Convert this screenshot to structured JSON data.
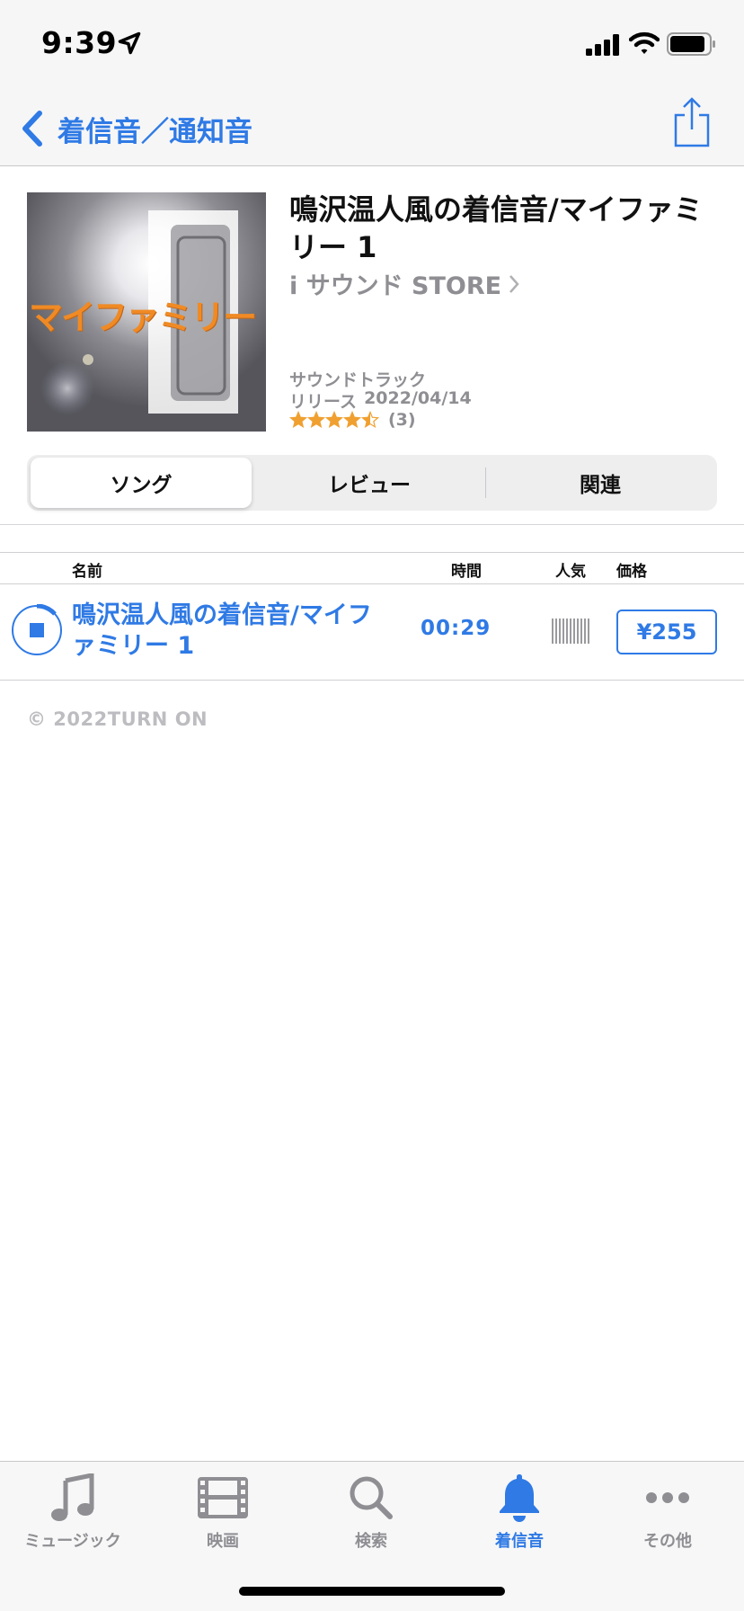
{
  "status_bar": {
    "time": "9:39",
    "icons": [
      "location-arrow-icon",
      "signal-icon",
      "wifi-icon",
      "battery-icon"
    ]
  },
  "nav": {
    "back_label": "着信音／通知音",
    "share_icon": "share-icon"
  },
  "album": {
    "artwork_text": "マイファミリー",
    "title": "鳴沢温人風の着信音/マイファミリー 1",
    "artist": "i サウンド STORE",
    "genre": "サウンドトラック",
    "release_label": "リリース",
    "release_date": "2022/04/14",
    "rating_stars": 4.5,
    "rating_count": "(3)"
  },
  "segments": [
    {
      "label": "ソング",
      "selected": true
    },
    {
      "label": "レビュー",
      "selected": false
    },
    {
      "label": "関連",
      "selected": false
    }
  ],
  "table": {
    "headers": {
      "name": "名前",
      "time": "時間",
      "popularity": "人気",
      "price": "価格"
    },
    "rows": [
      {
        "name": "鳴沢温人風の着信音/マイファミリー 1",
        "time": "00:29",
        "price": "¥255"
      }
    ]
  },
  "copyright": "© 2022TURN ON",
  "tabs": [
    {
      "label": "ミュージック",
      "icon": "music-note-icon",
      "active": false
    },
    {
      "label": "映画",
      "icon": "film-icon",
      "active": false
    },
    {
      "label": "検索",
      "icon": "search-icon",
      "active": false
    },
    {
      "label": "着信音",
      "icon": "bell-icon",
      "active": true
    },
    {
      "label": "その他",
      "icon": "more-icon",
      "active": false
    }
  ],
  "colors": {
    "accent": "#2f7ae5",
    "secondary_text": "#8e8e93",
    "star": "#f0a030",
    "artwork_text": "#f08a24"
  }
}
